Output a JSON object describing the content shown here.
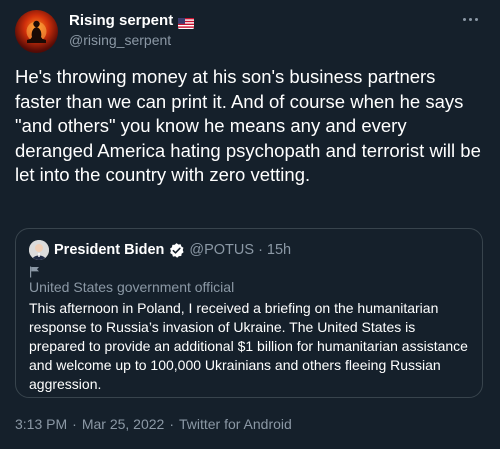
{
  "author": {
    "display_name": "Rising serpent",
    "handle": "@rising_serpent",
    "flag_icon": "us-flag-icon"
  },
  "tweet": {
    "text": "He's throwing money at his son's business partners faster than we can print it. And of course when he says \"and others\" you know he means any and every deranged America hating psychopath and terrorist will be let into the country with zero vetting."
  },
  "quoted_tweet": {
    "display_name": "President Biden",
    "handle": "@POTUS",
    "separator": "·",
    "time": "15h",
    "label": "United States government official",
    "text": "This afternoon in Poland, I received a briefing on the humanitarian response to Russia’s invasion of Ukraine. The United States is prepared to provide an additional $1 billion for humanitarian assistance and welcome up to 100,000 Ukrainians and others fleeing Russian aggression."
  },
  "meta": {
    "time": "3:13 PM",
    "separator": "·",
    "date": "Mar 25, 2022",
    "source": "Twitter for Android"
  },
  "colors": {
    "background": "#15202b",
    "text_primary": "#ffffff",
    "text_secondary": "#8b98a5",
    "border": "#38444d",
    "verified": "#1d9bf0"
  }
}
